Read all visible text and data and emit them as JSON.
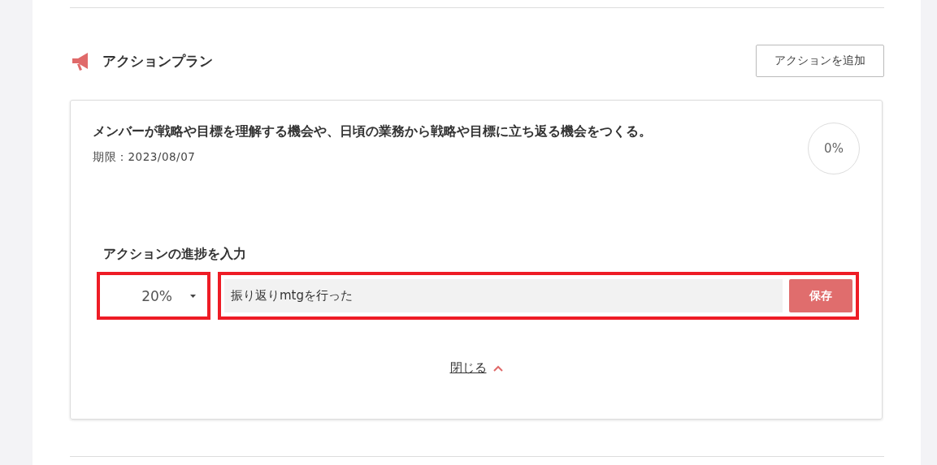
{
  "section": {
    "title": "アクションプラン",
    "add_button": "アクションを追加"
  },
  "action": {
    "title": "メンバーが戦略や目標を理解する機会や、日頃の業務から戦略や目標に立ち返る機会をつくる。",
    "deadline": "期限：2023/08/07",
    "progress": "0%"
  },
  "progress_form": {
    "label": "アクションの進捗を入力",
    "percent": "20%",
    "note": "振り返りmtgを行った",
    "save_button": "保存"
  },
  "close_link": "閉じる"
}
